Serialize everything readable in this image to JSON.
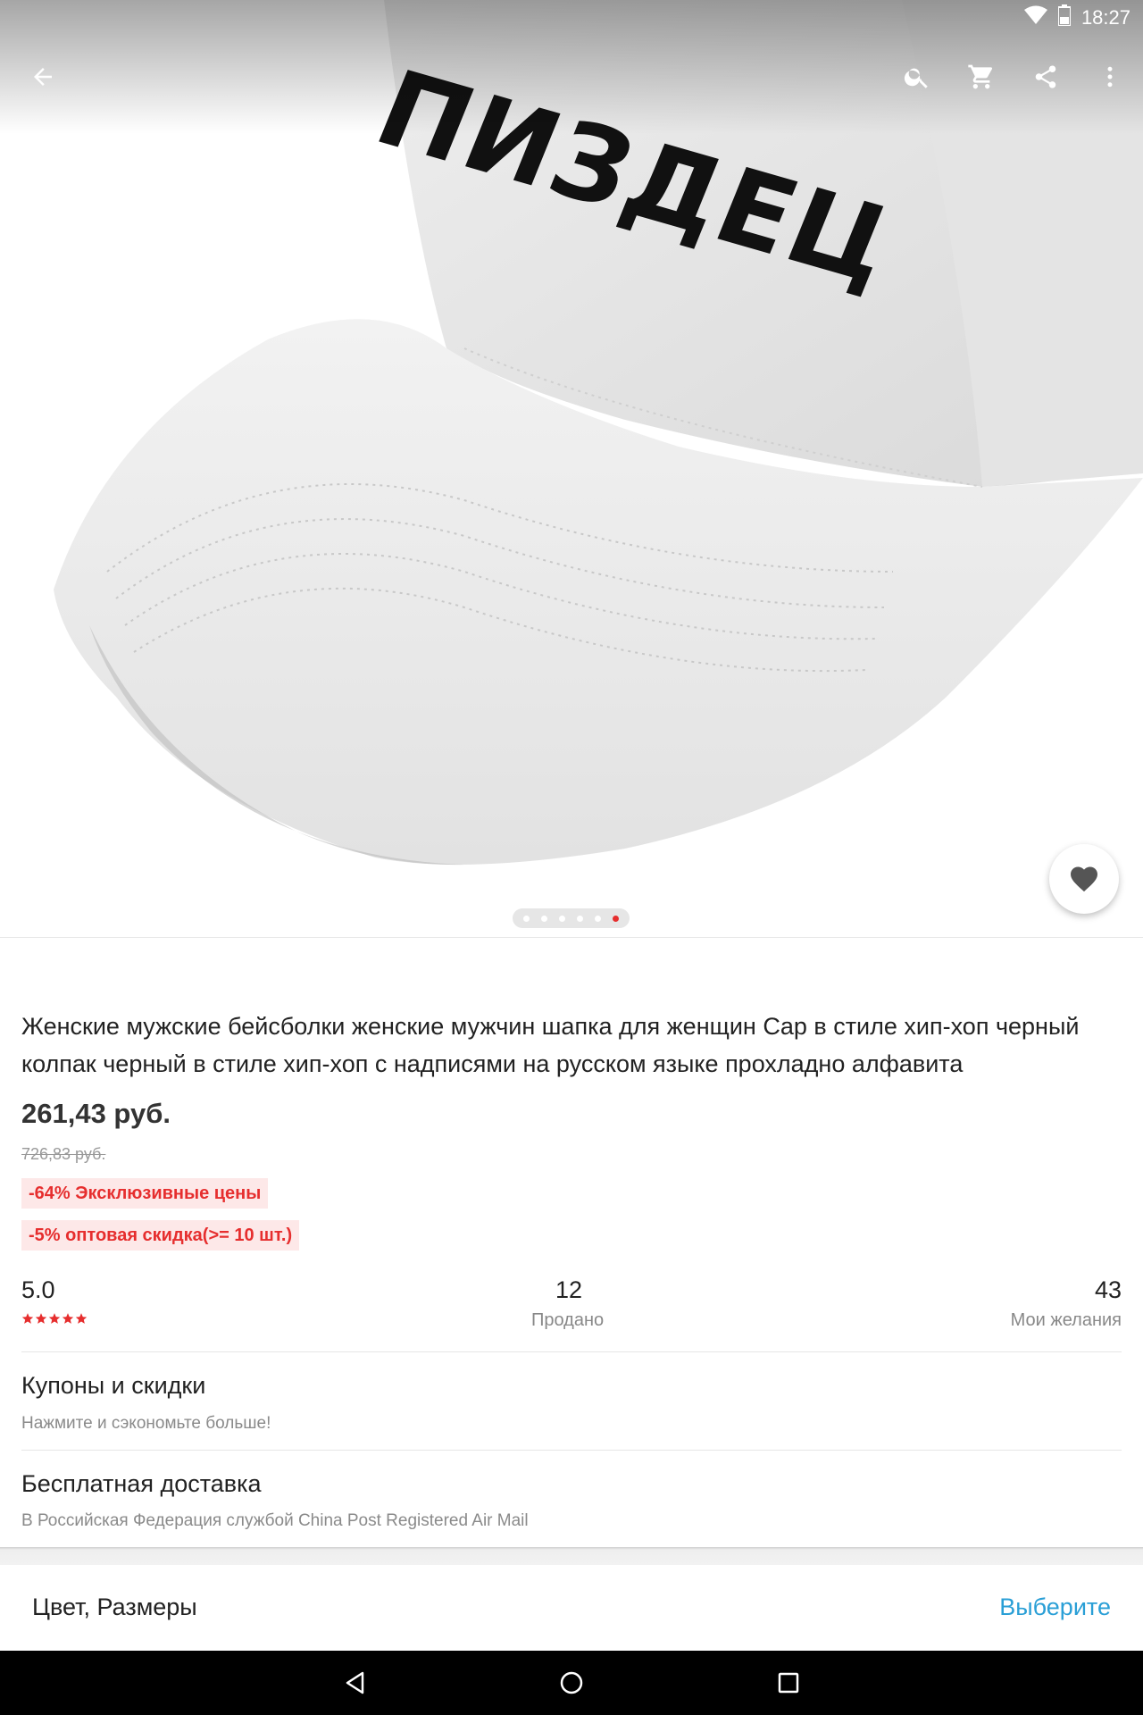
{
  "status_bar": {
    "time": "18:27"
  },
  "hero": {
    "cap_embroidery": "ПИЗДЕЦ",
    "page_count": 6,
    "active_page": 6
  },
  "toolbar": {
    "back_icon": "arrow-back-icon",
    "search_icon": "search-icon",
    "cart_icon": "cart-icon",
    "share_icon": "share-icon",
    "more_icon": "more-vert-icon"
  },
  "product": {
    "title": "Женские мужские бейсболки женские мужчин шапка для женщин Cap в стиле хип-хоп черный колпак черный в стиле хип-хоп с надписями на русском языке прохладно алфавита",
    "price": "261,43 руб.",
    "old_price": "726,83 руб.",
    "promos": [
      "-64% Эксклюзивные цены",
      "-5% оптовая скидка(>= 10 шт.)"
    ]
  },
  "stats": {
    "rating": "5.0",
    "stars": 5,
    "sold_value": "12",
    "sold_label": "Продано",
    "wish_value": "43",
    "wish_label": "Мои желания"
  },
  "coupons": {
    "title": "Купоны и скидки",
    "subtitle": "Нажмите и сэкономьте больше!"
  },
  "shipping": {
    "title": "Бесплатная доставка",
    "subtitle": "В Российская Федерация службой China Post Registered Air Mail"
  },
  "bottom_bar": {
    "label": "Цвет, Размеры",
    "action": "Выберите"
  },
  "colors": {
    "accent_red": "#e62e2e",
    "link_blue": "#2a9fd6",
    "promo_bg": "#fde8e8"
  }
}
